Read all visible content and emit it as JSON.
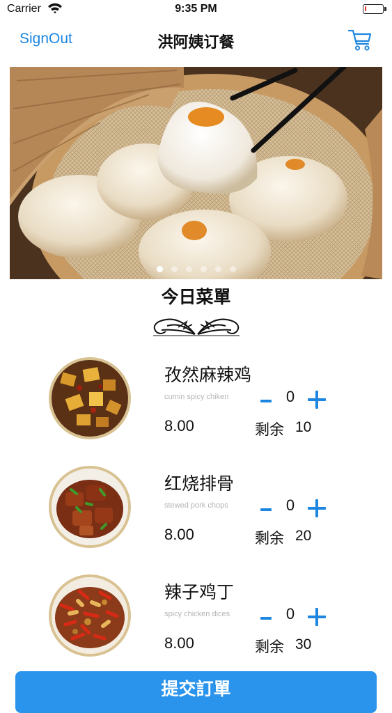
{
  "status_bar": {
    "carrier": "Carrier",
    "time": "9:35 PM",
    "battery_level": 0.1,
    "battery_color": "#e02525"
  },
  "nav": {
    "signout_label": "SignOut",
    "title": "洪阿姨订餐",
    "cart_icon": "cart-icon"
  },
  "banner": {
    "page_count": 6,
    "active_page": 1
  },
  "menu": {
    "title": "今日菜單",
    "items": [
      {
        "name": "孜然麻辣鸡",
        "english": "cumin spicy chiken",
        "quantity": "0",
        "price": "8.00",
        "stock_label": "剩余",
        "stock": "10"
      },
      {
        "name": "红烧排骨",
        "english": "stewed pork chops",
        "quantity": "0",
        "price": "8.00",
        "stock_label": "剩余",
        "stock": "20"
      },
      {
        "name": "辣子鸡丁",
        "english": "spicy chicken dices",
        "quantity": "0",
        "price": "8.00",
        "stock_label": "剩余",
        "stock": "30"
      }
    ]
  },
  "submit_label": "提交訂單",
  "colors": {
    "accent": "#1d86e0",
    "button": "#2a93ec",
    "dish_border": "#d9c292"
  }
}
